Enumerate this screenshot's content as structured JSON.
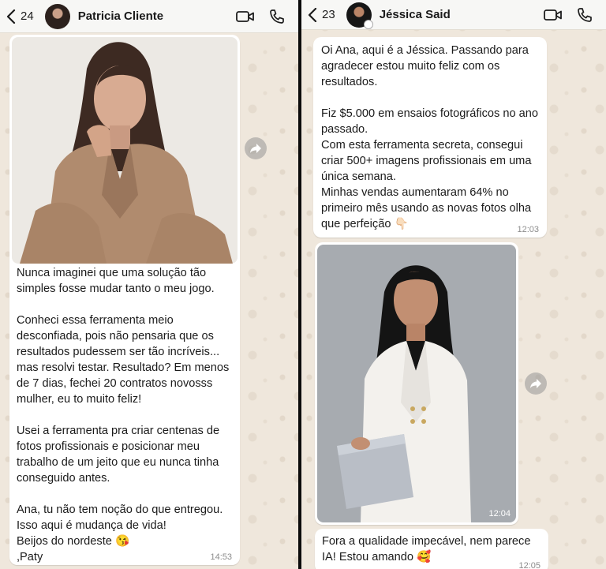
{
  "left_chat": {
    "unread_count": "24",
    "contact_name": "Patricia Cliente",
    "message_text": "Nunca imaginei que uma solução tão simples fosse mudar tanto o meu jogo.\n\nConheci essa ferramenta meio desconfiada, pois não pensaria que os resultados pudessem ser tão incríveis... mas resolvi testar. Resultado? Em menos de 7 dias, fechei 20 contratos novosss mulher, eu to muito feliz!\n\nUsei a ferramenta pra criar centenas de fotos profissionais e posicionar meu trabalho de um jeito que eu nunca tinha conseguido antes.\n\nAna, tu não tem noção do que entregou. Isso aqui é mudança de vida!\nBeijos do nordeste 😘\n,Paty",
    "message_time": "14:53"
  },
  "right_chat": {
    "unread_count": "23",
    "contact_name": "Jéssica Said",
    "message1_text": "Oi Ana, aqui é a Jéssica. Passando para agradecer estou muito feliz com os resultados.\n\nFiz $5.000 em ensaios fotográficos no ano passado.\nCom esta ferramenta secreta, consegui criar 500+ imagens profissionais em uma única semana.\nMinhas vendas aumentaram 64% no primeiro mês usando as novas fotos olha que perfeição 👇🏻",
    "message1_time": "12:03",
    "photo_time": "12:04",
    "message2_text": "Fora a qualidade impecável, nem parece IA! Estou amando 🥰",
    "message2_time": "12:05"
  },
  "icons": [
    "back-chevron-icon",
    "avatar",
    "video-call-icon",
    "phone-call-icon",
    "forward-icon"
  ],
  "colors": {
    "chat_background": "#efe7dc",
    "bubble": "#ffffff",
    "header": "#f7f7f5",
    "timestamp": "#8b8b8b"
  }
}
